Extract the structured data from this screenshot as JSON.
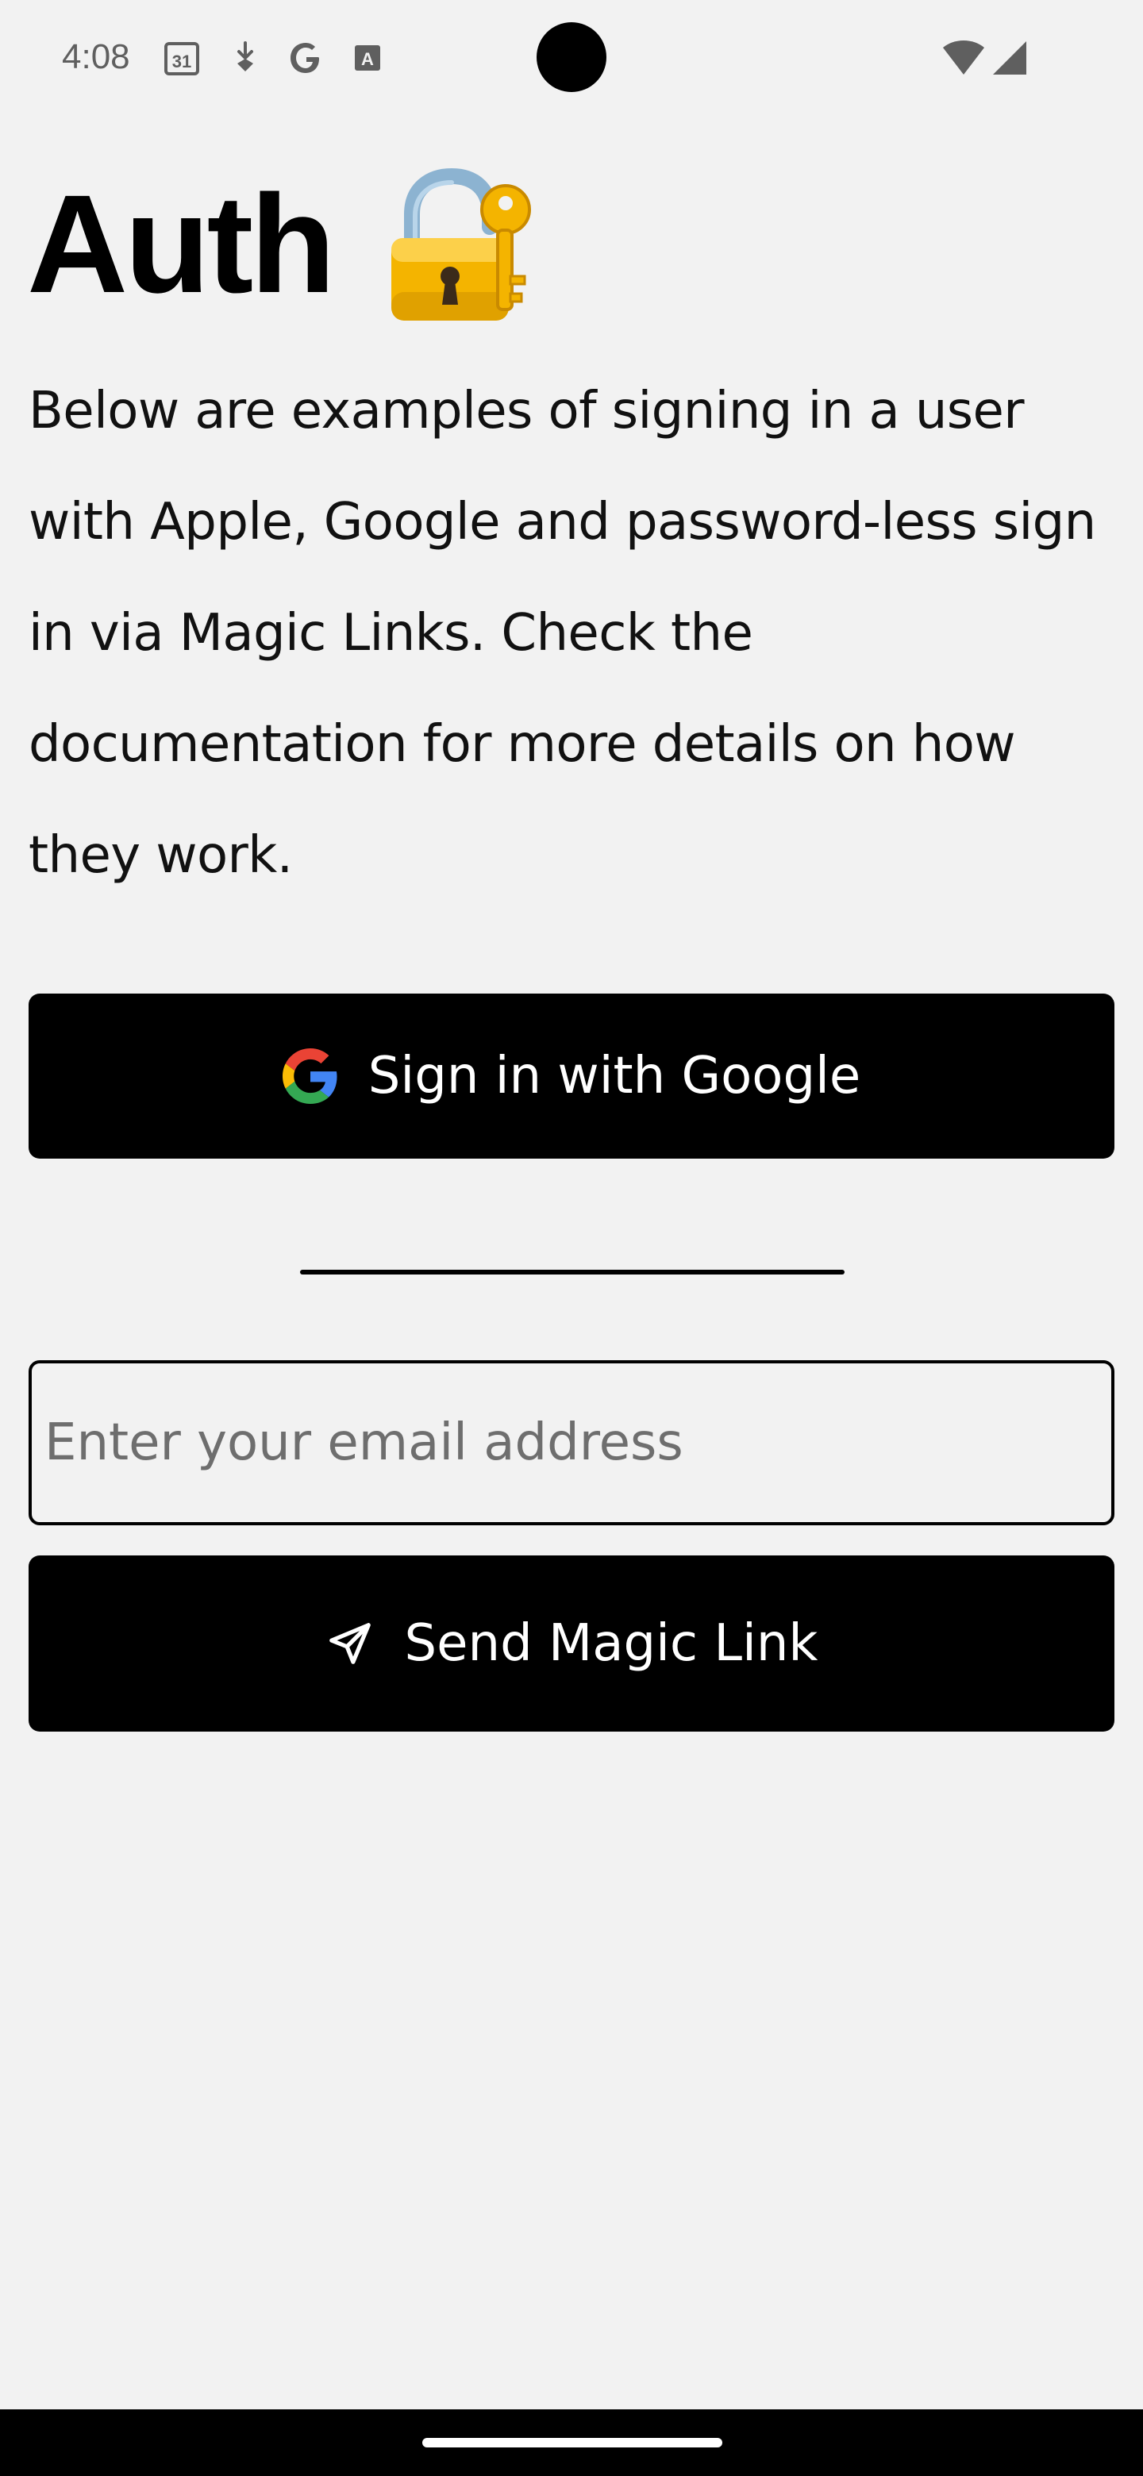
{
  "status_bar": {
    "time": "4:08",
    "calendar_day": "31",
    "icons": [
      "calendar-icon",
      "download-icon",
      "google-g-icon",
      "font-icon",
      "wifi-icon",
      "signal-icon"
    ]
  },
  "header": {
    "title": "Auth",
    "title_emoji_icon": "lock-with-key-icon"
  },
  "description": "Below are examples of signing in a user with Apple, Google and password-less sign in via Magic Links. Check the documentation for more details on how they work.",
  "google_button": {
    "label": "Sign in with Google",
    "icon": "google-logo-icon"
  },
  "magic_link": {
    "email_placeholder": "Enter your email address",
    "email_value": "",
    "button_label": "Send Magic Link",
    "button_icon": "send-icon"
  },
  "colors": {
    "background": "#f2f2f2",
    "button_bg": "#000000",
    "button_text": "#ffffff",
    "google_blue": "#4285F4",
    "google_red": "#EA4335",
    "google_yellow": "#FBBC05",
    "google_green": "#34A853"
  }
}
